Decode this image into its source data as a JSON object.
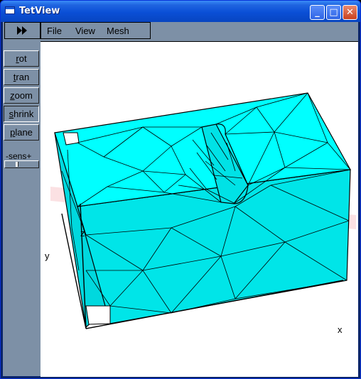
{
  "window": {
    "title": "TetView"
  },
  "titlebar_buttons": {
    "minimize": "_",
    "maximize": "□",
    "close": "✕"
  },
  "toolbar": {
    "menu": [
      "File",
      "View",
      "Mesh"
    ]
  },
  "side": {
    "buttons": [
      {
        "key": "r",
        "rest": "ot"
      },
      {
        "key": "t",
        "rest": "ran"
      },
      {
        "key": "z",
        "rest": "oom"
      },
      {
        "key": "s",
        "rest": "hrink"
      },
      {
        "key": "p",
        "rest": "lane"
      }
    ],
    "active": "shrink",
    "sensitivity_label": "-sens+",
    "sensitivity": 0.35
  },
  "viewport": {
    "axes": {
      "x": "x",
      "y": "y",
      "z": "z"
    },
    "colors": {
      "background": "#ffffff",
      "mesh_face": "#00ffff",
      "mesh_face_shade": "#00d8de",
      "edge": "#000000",
      "axis_bar": "#f7c9cc"
    }
  }
}
